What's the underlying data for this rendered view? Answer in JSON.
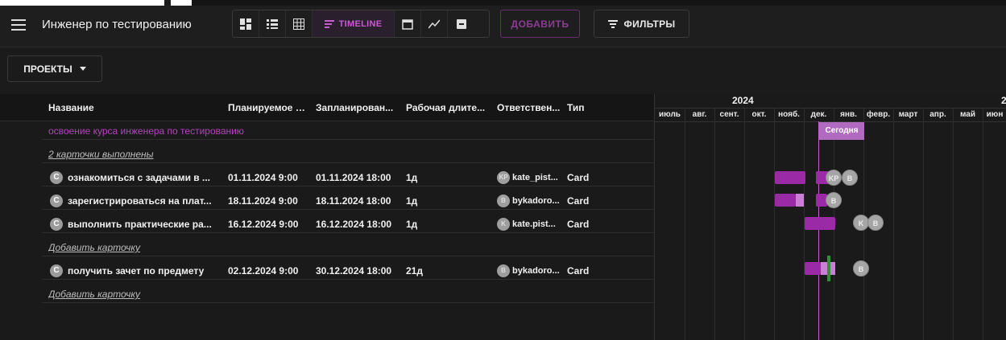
{
  "header": {
    "title": "Инженер по тестированию",
    "timeline_label": "TIMELINE",
    "add_label": "ДОБАВИТЬ",
    "filters_label": "ФИЛЬТРЫ"
  },
  "projects_label": "ПРОЕКТЫ",
  "table": {
    "columns": [
      "Название",
      "Планируемое н...",
      "Запланирован...",
      "Рабочая длите...",
      "Ответствен...",
      "Тип"
    ],
    "group_title": "освоение курса инженера по тестированию",
    "done_link": "2 карточки выполнены",
    "add_card": "Добавить карточку",
    "rows": [
      {
        "badge": "C",
        "name": "ознакомиться с задачами в ...",
        "start": "01.11.2024 9:00",
        "end": "01.11.2024 18:00",
        "duration": "1д",
        "avatar": "KP",
        "assignee": "kate_pist...",
        "type": "Card"
      },
      {
        "badge": "C",
        "name": "зарегистрироваться на плат...",
        "start": "18.11.2024 9:00",
        "end": "18.11.2024 18:00",
        "duration": "1д",
        "avatar": "B",
        "assignee": "bykadoro...",
        "type": "Card"
      },
      {
        "badge": "C",
        "name": "выполнить практические ра...",
        "start": "16.12.2024 9:00",
        "end": "16.12.2024 18:00",
        "duration": "1д",
        "avatar": "K",
        "assignee": "kate.pist...",
        "type": "Card"
      },
      {
        "badge": "C",
        "name": "получить зачет по предмету",
        "start": "02.12.2024 9:00",
        "end": "30.12.2024 18:00",
        "duration": "21д",
        "avatar": "B",
        "assignee": "bykadoro...",
        "type": "Card"
      }
    ]
  },
  "timeline": {
    "year": "2024",
    "next_year": "2",
    "months": [
      "июль",
      "авг.",
      "сент.",
      "окт.",
      "нояб.",
      "дек.",
      "янв.",
      "февр.",
      "март",
      "апр.",
      "май",
      "июн"
    ],
    "today_label": "Сегодня",
    "avatars": [
      "KP",
      "B",
      "B",
      "K",
      "B",
      "B"
    ]
  },
  "colors": {
    "accent": "#c85bd0",
    "bar": "#9a2aa5",
    "bar_light": "#c97fd3",
    "marker": "#2f8f3a",
    "background": "#1b1b1b"
  }
}
